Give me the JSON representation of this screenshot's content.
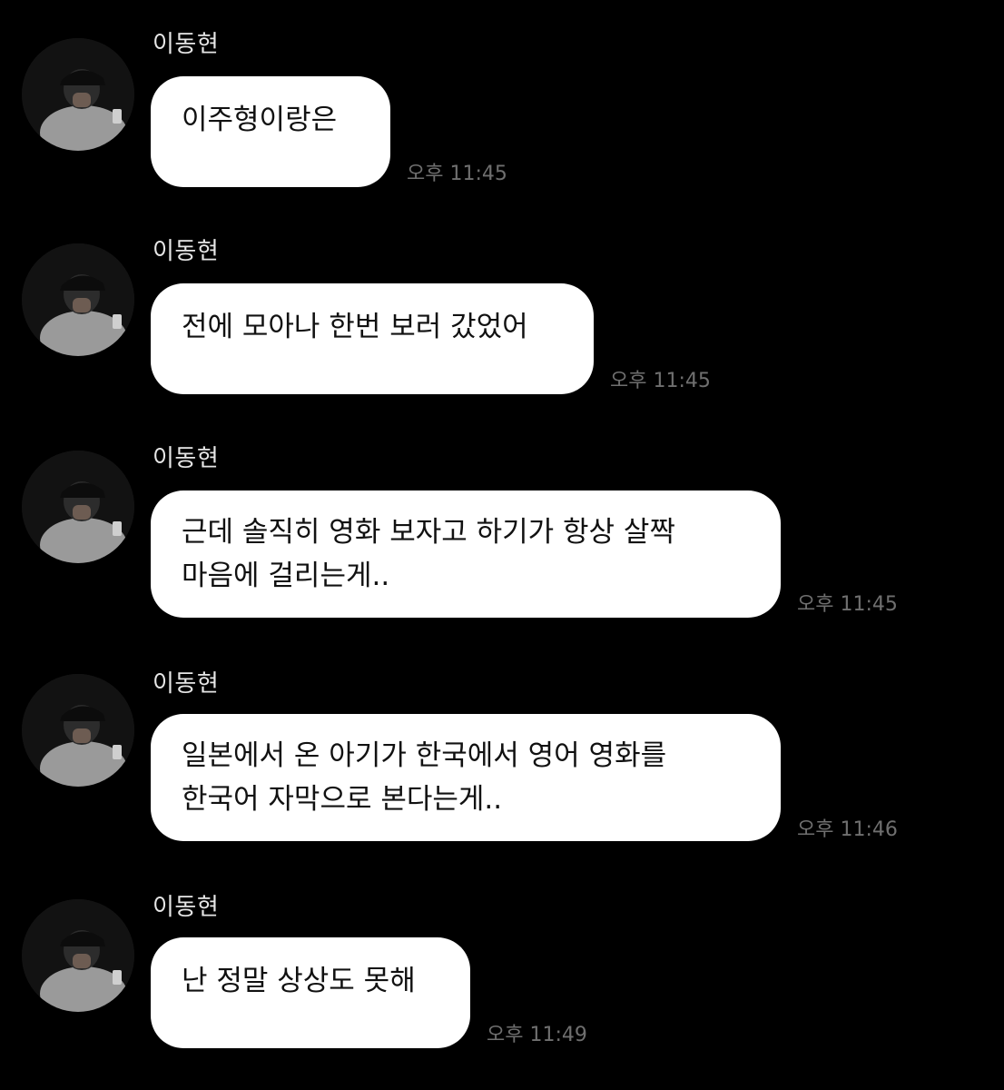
{
  "messages": [
    {
      "sender": "이동현",
      "text": "이주형이랑은",
      "time": "오후 11:45"
    },
    {
      "sender": "이동현",
      "text": "전에 모아나 한번 보러 갔었어",
      "time": "오후 11:45"
    },
    {
      "sender": "이동현",
      "text": "근데 솔직히 영화 보자고 하기가 항상 살짝\n마음에 걸리는게..",
      "time": "오후 11:45"
    },
    {
      "sender": "이동현",
      "text": "일본에서 온 아기가 한국에서 영어 영화를\n한국어 자막으로 본다는게..",
      "time": "오후 11:46"
    },
    {
      "sender": "이동현",
      "text": "난 정말 상상도 못해",
      "time": "오후 11:49"
    }
  ],
  "colors": {
    "background": "#000000",
    "bubble": "#ffffff",
    "bubble_text": "#111111",
    "sender_text": "#e6e6e6",
    "time_text": "#6f6f6f"
  },
  "icons": {
    "avatar": "profile-photo-avatar"
  }
}
